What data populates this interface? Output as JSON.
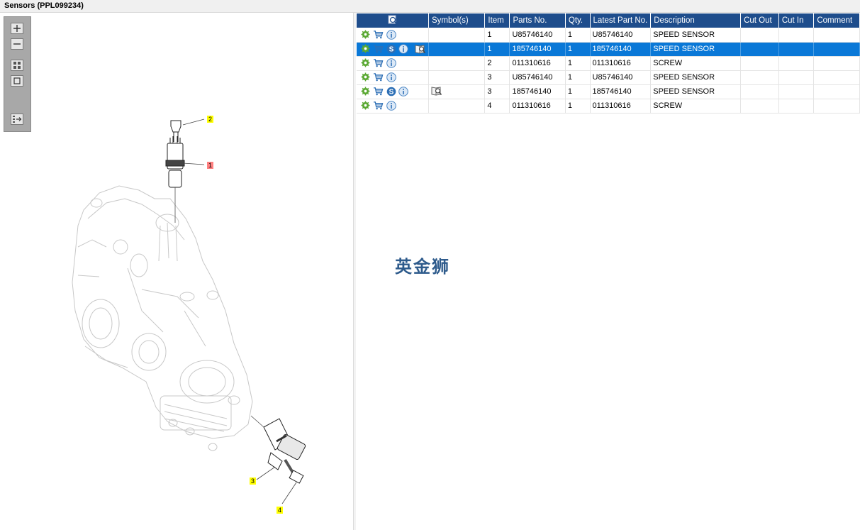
{
  "window": {
    "title": "Sensors (PPL099234)"
  },
  "toolbar": {
    "buttons": [
      {
        "name": "zoom-in-button",
        "icon": "plus-icon"
      },
      {
        "name": "zoom-out-button",
        "icon": "minus-icon"
      },
      {
        "name": "fit-all-button",
        "icon": "grid-icon"
      },
      {
        "name": "actual-size-button",
        "icon": "square-icon"
      },
      {
        "name": "export-button",
        "icon": "list-arrow-icon"
      }
    ]
  },
  "drawing": {
    "callouts": [
      {
        "label": "2",
        "color": "#ffff00"
      },
      {
        "label": "1",
        "color": "#ff8080"
      },
      {
        "label": "3",
        "color": "#ffff00"
      },
      {
        "label": "4",
        "color": "#ffff00"
      }
    ]
  },
  "parts_table": {
    "columns": [
      "",
      "Symbol(s)",
      "Item",
      "Parts No.",
      "Qty.",
      "Latest Part No.",
      "Description",
      "Cut Out",
      "Cut In",
      "Comment"
    ],
    "rows": [
      {
        "item": "1",
        "parts_no": "U85746140",
        "qty": "1",
        "latest": "U85746140",
        "description": "SPEED SENSOR",
        "cut_out": "",
        "cut_in": "",
        "comment": "",
        "supersession": false,
        "symbol": false,
        "selected": false
      },
      {
        "item": "1",
        "parts_no": "185746140",
        "qty": "1",
        "latest": "185746140",
        "description": "SPEED SENSOR",
        "cut_out": "",
        "cut_in": "",
        "comment": "",
        "supersession": true,
        "symbol": true,
        "selected": true
      },
      {
        "item": "2",
        "parts_no": "011310616",
        "qty": "1",
        "latest": "011310616",
        "description": "SCREW",
        "cut_out": "",
        "cut_in": "",
        "comment": "",
        "supersession": false,
        "symbol": false,
        "selected": false
      },
      {
        "item": "3",
        "parts_no": "U85746140",
        "qty": "1",
        "latest": "U85746140",
        "description": "SPEED SENSOR",
        "cut_out": "",
        "cut_in": "",
        "comment": "",
        "supersession": false,
        "symbol": false,
        "selected": false
      },
      {
        "item": "3",
        "parts_no": "185746140",
        "qty": "1",
        "latest": "185746140",
        "description": "SPEED SENSOR",
        "cut_out": "",
        "cut_in": "",
        "comment": "",
        "supersession": true,
        "symbol": true,
        "selected": false
      },
      {
        "item": "4",
        "parts_no": "011310616",
        "qty": "1",
        "latest": "011310616",
        "description": "SCREW",
        "cut_out": "",
        "cut_in": "",
        "comment": "",
        "supersession": false,
        "symbol": false,
        "selected": false
      }
    ]
  },
  "watermark": {
    "text": "英金狮"
  },
  "colors": {
    "header": "#1e4d8c",
    "selected_row": "#0a78d7",
    "callout_yellow": "#ffff00",
    "callout_red": "#ff8080"
  }
}
